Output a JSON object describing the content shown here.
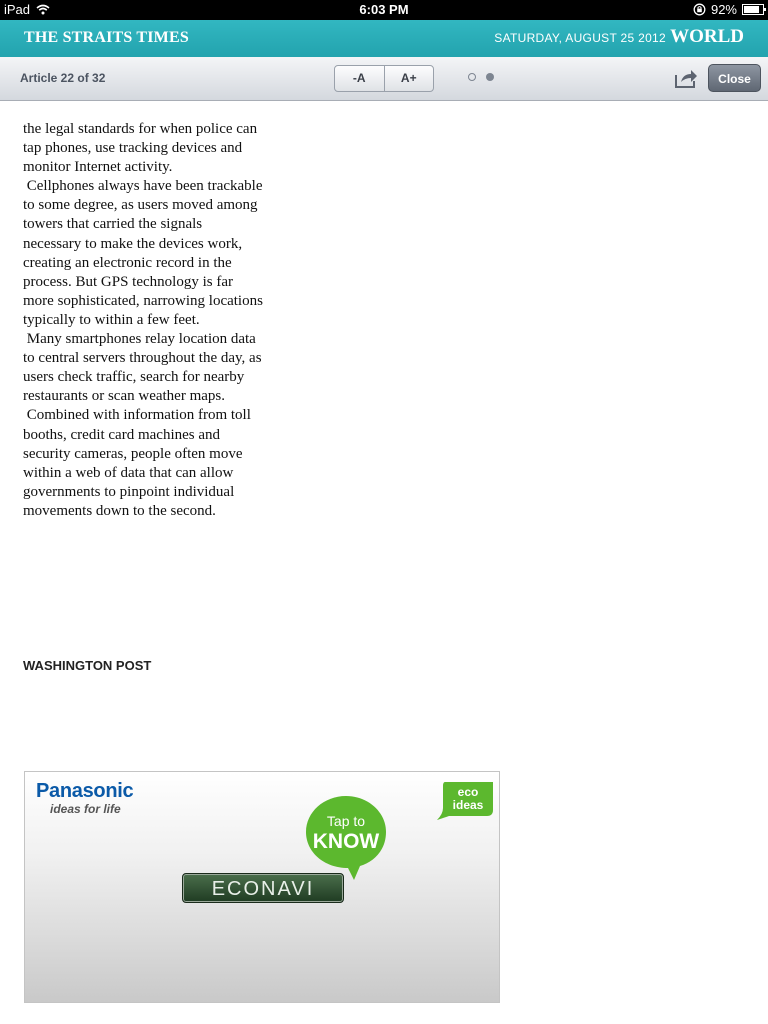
{
  "status_bar": {
    "device": "iPad",
    "time": "6:03 PM",
    "battery": "92%",
    "battery_level": 0.92
  },
  "masthead": {
    "brand": "THE STRAITS TIMES",
    "date": "SATURDAY, AUGUST 25 2012",
    "section": "WORLD"
  },
  "toolbar": {
    "article_counter": "Article 22 of 32",
    "font_smaller": "-A",
    "font_larger": "A+",
    "page_dots": 2,
    "active_dot": 2,
    "close_label": "Close"
  },
  "article": {
    "paragraphs": [
      "the legal standards for when police can tap phones, use tracking devices and monitor Internet activity.",
      " Cellphones always have been trackable to some degree, as users moved among towers that carried the signals necessary to make the devices work, creating an electronic record in the process. But GPS technology is far more sophisticated, narrowing locations typically to within a few feet.",
      " Many smartphones relay location data to central servers throughout the day, as users check traffic, search for nearby restaurants or scan weather maps.",
      " Combined with information from toll booths, credit card machines and security cameras, people often move within a web of data that can allow governments to pinpoint individual movements down to the second."
    ],
    "byline": "WASHINGTON POST"
  },
  "ad": {
    "brand": "Panasonic",
    "tagline": "ideas for life",
    "bubble_line1": "Tap to",
    "bubble_line2": "KNOW",
    "eco_line1": "eco",
    "eco_line2": "ideas",
    "product": "ECONAVI",
    "colors": {
      "brand": "#0b5aa8",
      "bubble": "#5cb82e"
    }
  }
}
